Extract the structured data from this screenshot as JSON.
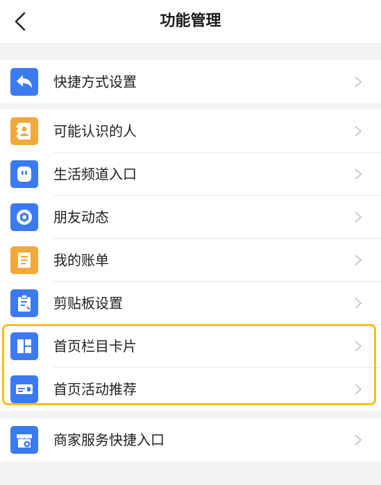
{
  "header": {
    "title": "功能管理"
  },
  "colors": {
    "icon_blue": "#3b7af0",
    "icon_orange": "#f2a93b",
    "highlight": "#fbbd17"
  },
  "group1": [
    {
      "label": "快捷方式设置",
      "icon": "reply-arrow-icon"
    }
  ],
  "group2": [
    {
      "label": "可能认识的人",
      "icon": "contact-book-icon"
    },
    {
      "label": "生活频道入口",
      "icon": "life-channel-icon"
    },
    {
      "label": "朋友动态",
      "icon": "aperture-icon"
    },
    {
      "label": "我的账单",
      "icon": "bill-icon"
    },
    {
      "label": "剪贴板设置",
      "icon": "clipboard-icon"
    },
    {
      "label": "首页栏目卡片",
      "icon": "grid-card-icon"
    },
    {
      "label": "首页活动推荐",
      "icon": "card-promo-icon"
    }
  ],
  "group3": [
    {
      "label": "商家服务快捷入口",
      "icon": "store-icon"
    }
  ]
}
